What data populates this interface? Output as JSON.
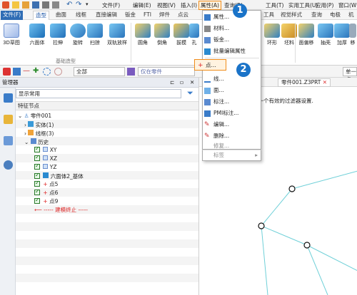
{
  "menubar": {
    "items": [
      "文件(F)",
      "编辑(E)",
      "视图(V)",
      "插入(I)",
      "属性(A)",
      "查询(R)",
      "工具(T)",
      "实用工具(U)",
      "应用(P)",
      "窗口(W)"
    ]
  },
  "tabs": [
    "文件(F)",
    "造型",
    "曲面",
    "线框",
    "直接编辑",
    "钣金",
    "FTI",
    "焊件",
    "点云",
    "工具",
    "视觉样式",
    "查询",
    "电极",
    "机"
  ],
  "ribbon": {
    "buttons": [
      "3D草图",
      "六面体",
      "拉伸",
      "旋转",
      "扫掠",
      "双轨放样",
      "圆角",
      "倒角",
      "拔模",
      "孔",
      "面偏移",
      "抽壳",
      "加厚",
      "移"
    ],
    "right_partial": [
      "环形",
      "坯料"
    ],
    "group_label": "基础造型"
  },
  "toolbar2": {
    "filter_value": "全部",
    "part_only": "仅在零件",
    "right_combo": "单一点"
  },
  "manager": {
    "title": "管理器",
    "search_value": "显示常用",
    "column_header": "特征节点",
    "tree": {
      "root": "零件001",
      "solid": "实体(1)",
      "wireframe": "线框(3)",
      "history": "历史",
      "planes": [
        "XY",
        "XZ",
        "YZ"
      ],
      "feature": "六面体2_基体",
      "points": [
        "点5",
        "点6",
        "点9"
      ],
      "rollback": "----- 建模终止 -----"
    }
  },
  "viewport": {
    "tab_label": "零件001.Z3PRT",
    "message": "查找下一个有效的过滤器设置."
  },
  "dropdown": {
    "items": [
      "属性...",
      "材料...",
      "钣金...",
      "批量编辑属性",
      "点...",
      "线...",
      "面...",
      "标注...",
      "PMI标注...",
      "编辑...",
      "删除...",
      "修复...",
      "标签"
    ]
  },
  "badges": [
    "1",
    "2"
  ],
  "colors": {
    "accent": "#1a73c8",
    "highlight": "#f08c1a",
    "cyan_line": "#6fd0d8"
  }
}
